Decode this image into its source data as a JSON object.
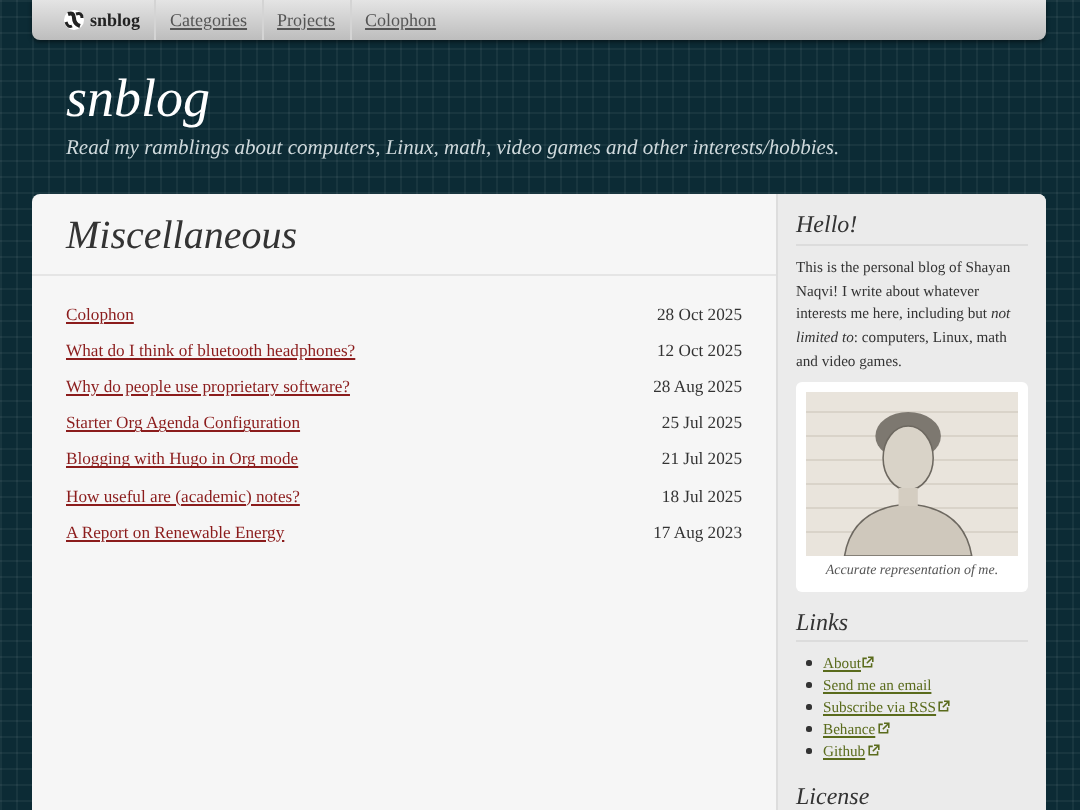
{
  "navbar": {
    "brand": "snblog",
    "items": [
      {
        "label": "Categories"
      },
      {
        "label": "Projects"
      },
      {
        "label": "Colophon"
      }
    ]
  },
  "header": {
    "title": "snblog",
    "tagline": "Read my ramblings about computers, Linux, math, video games and other interests/hobbies."
  },
  "main": {
    "title": "Miscellaneous",
    "posts": [
      {
        "title": "Colophon",
        "date": "28 Oct 2025"
      },
      {
        "title": "What do I think of bluetooth headphones?",
        "date": "12 Oct 2025"
      },
      {
        "title": "Why do people use proprietary software?",
        "date": "28 Aug 2025"
      },
      {
        "title": "Starter Org Agenda Configuration",
        "date": "25 Jul 2025"
      },
      {
        "title": "Blogging with Hugo in Org mode",
        "date": "21 Jul 2025"
      },
      {
        "title": "How useful are (academic) notes?",
        "date": "18 Jul 2025"
      },
      {
        "title": "A Report on Renewable Energy",
        "date": "17 Aug 2023"
      }
    ]
  },
  "sidebar": {
    "hello": {
      "title": "Hello!",
      "text": "This is the personal blog of Shayan Naqvi! I write about whatever interests me here, including but *not limited to*: computers, Linux, math and video games.",
      "caption": "Accurate representation of me."
    },
    "links": {
      "title": "Links",
      "items": [
        {
          "label": "About",
          "external": true
        },
        {
          "label": "Send me an email",
          "external": false
        },
        {
          "label": "Subscribe via RSS",
          "external": true
        },
        {
          "label": "Behance",
          "external": true
        },
        {
          "label": "Github",
          "external": true
        }
      ]
    },
    "license": {
      "title": "License"
    }
  }
}
